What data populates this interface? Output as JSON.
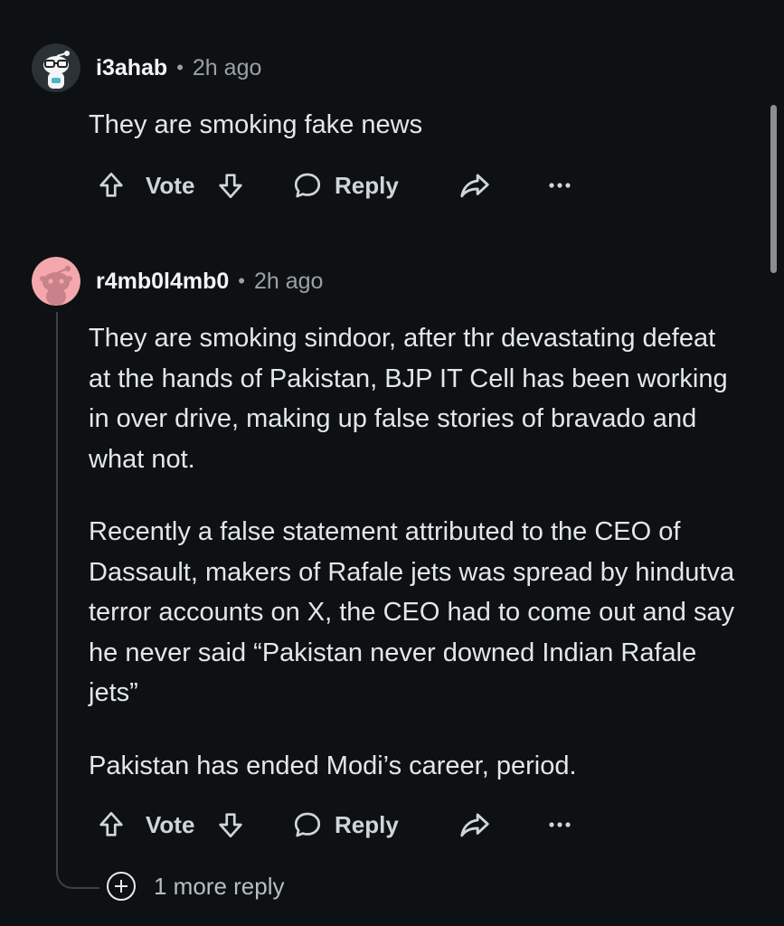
{
  "comments": [
    {
      "username": "i3ahab",
      "time": "2h ago",
      "paragraphs": [
        "They are smoking fake news"
      ],
      "actions": {
        "vote": "Vote",
        "reply": "Reply"
      }
    },
    {
      "username": "r4mb0l4mb0",
      "time": "2h ago",
      "paragraphs": [
        "They are smoking sindoor, after thr devastating defeat at the hands of Pakistan, BJP IT Cell has been working in over drive, making up false stories of bravado and what not.",
        "Recently a false statement attributed to the CEO of Dassault, makers of Rafale jets was spread by hindutva terror accounts on X, the CEO had to come out and say he never said “Pakistan never downed Indian Rafale jets”",
        "Pakistan has ended Modi’s career, period."
      ],
      "actions": {
        "vote": "Vote",
        "reply": "Reply"
      }
    }
  ],
  "more_replies": "1 more reply",
  "separator": "•",
  "colors": {
    "background": "#0e1113",
    "text": "#e2e7ea",
    "muted": "#9aa1a5",
    "thread_line": "#3b4144",
    "avatar2_bg": "#f4a8ae"
  },
  "icons": [
    "avatar-snoo-glasses",
    "avatar-snoo-pink",
    "upvote-icon",
    "downvote-icon",
    "comment-bubble-icon",
    "share-icon",
    "more-options-icon",
    "plus-circle-icon"
  ]
}
